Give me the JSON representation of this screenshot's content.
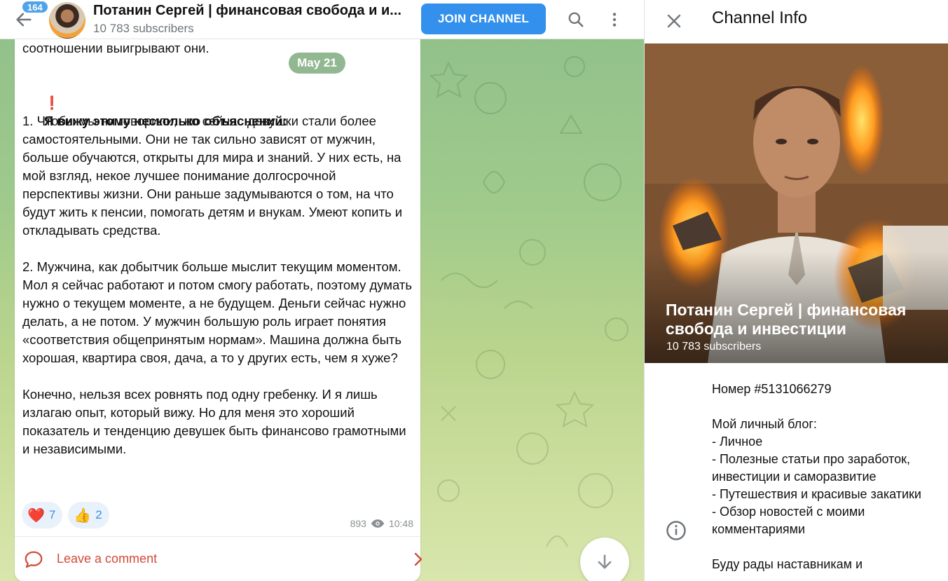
{
  "topbar": {
    "unread_count": "164",
    "title": "Потанин Сергей | финансовая свобода и и...",
    "subscribers": "10 783 subscribers",
    "join_label": "JOIN CHANNEL"
  },
  "message": {
    "lead_in": "соотношении выигрывают они.",
    "date_pill": "May 21",
    "heading": "Я вижу этому несколько объяснений:",
    "body": "1. Чтобы мы ни говорили,  но сейчас девушки стали более самостоятельными. Они не так сильно зависят от мужчин, больше обучаются, открыты для мира и знаний. У них есть, на мой взгляд, некое лучшее понимание долгосрочной перспективы жизни. Они раньше задумываются о том, на что будут жить к пенсии, помогать детям и внукам. Умеют копить и откладывать средства.\n\n2. Мужчина, как добытчик больше мыслит текущим моментом. Мол я сейчас работают и потом смогу работать, поэтому думать нужно о текущем моменте, а не будущем. Деньги сейчас нужно делать, а не потом. У мужчин большую роль играет понятия «соответствия общепринятым нормам». Машина должна быть хорошая, квартира своя, дача, а то у других есть, чем я хуже?\n\nКонечно, нельзя всех ровнять под одну гребенку. И я лишь излагаю опыт, который вижу. Но для меня это хороший показатель и тенденцию девушек быть финансово грамотными и независимыми.",
    "reactions": [
      {
        "emoji": "❤️",
        "count": "7"
      },
      {
        "emoji": "👍",
        "count": "2"
      }
    ],
    "views": "893",
    "time": "10:48",
    "comment_label": "Leave a comment"
  },
  "info_panel": {
    "title": "Channel Info",
    "channel_name": "Потанин Сергей | финансовая свобода и инвестиции",
    "subscribers": "10 783 subscribers",
    "description": "Номер #5131066279\n\nМой личный блог:\n- Личное\n- Полезные статьи про заработок, инвестиции и саморазвитие\n- Путешествия и красивые закатики\n- Обзор новостей с моими комментариями\n\nБуду рады наставникам и"
  },
  "colors": {
    "accent": "#3390ec",
    "comment": "#d14a3a",
    "chat_bg": "#9fca8c"
  },
  "icons": [
    "back-arrow-icon",
    "search-icon",
    "more-vertical-icon",
    "exclamation-icon",
    "eye-icon",
    "comment-icon",
    "chevron-right-icon",
    "arrow-down-icon",
    "close-icon",
    "info-icon"
  ]
}
